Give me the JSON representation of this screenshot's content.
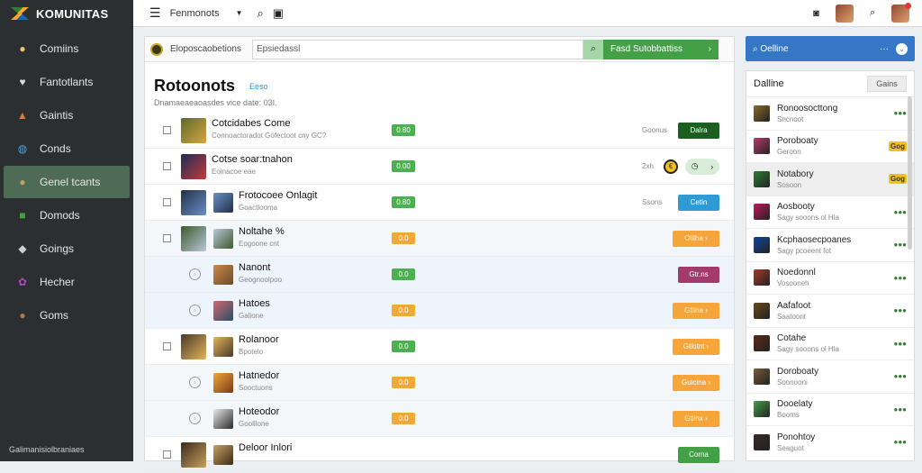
{
  "brand": {
    "name": "KOMUNITAS"
  },
  "sidebar": {
    "items": [
      {
        "label": "Comiins",
        "icon": "person-icon",
        "color": "#f0c070"
      },
      {
        "label": "Fantotlants",
        "icon": "heart-icon",
        "color": "#d8d8d8"
      },
      {
        "label": "Gaintis",
        "icon": "fox-icon",
        "color": "#e07b39"
      },
      {
        "label": "Conds",
        "icon": "globe-icon",
        "color": "#4aa3df"
      },
      {
        "label": "Genel tcants",
        "icon": "person-icon",
        "color": "#c69b6d",
        "active": true
      },
      {
        "label": "Domods",
        "icon": "box-icon",
        "color": "#43a047"
      },
      {
        "label": "Goings",
        "icon": "gamepad-icon",
        "color": "#d0d0d0"
      },
      {
        "label": "Hecher",
        "icon": "palette-icon",
        "color": "#ab47bc"
      },
      {
        "label": "Goms",
        "icon": "person-icon",
        "color": "#b07a50"
      }
    ],
    "footer": "Galimanisiolbraniaes"
  },
  "topbar": {
    "breadcrumb": "Fenmonots",
    "menu_icon": "☰",
    "chevron": "▼",
    "search_icon": "⌕",
    "camera_icon": "▣",
    "bell_icon": "◙",
    "search_icon_right": "⌕"
  },
  "filterbar": {
    "label": "Eloposcaobetions",
    "search_value": "Epsiedassl",
    "search_icon": "⌕",
    "cta_label": "Fasd Sutobbattiss",
    "cta_chevron": "›"
  },
  "page": {
    "title": "Rotoonots",
    "tag": "Eeso",
    "subtitle": "Dnamaeaeaoasdes vice date: 03I."
  },
  "rows": [
    {
      "title": "Cotcidabes Come",
      "subtitle": "Connoactoradot Gofectoot cny GC?",
      "score": "0.80",
      "score_type": "g",
      "meta": "Goonus",
      "action": "Dalra",
      "action_type": "dark",
      "checkbox": true,
      "style": ""
    },
    {
      "title": "Cotse soar:tnahon",
      "subtitle": "Eoinacoe eae",
      "score": "0.00",
      "score_type": "g",
      "meta": "2xh",
      "action": "",
      "action_type": "pill",
      "checkbox": true,
      "style": ""
    },
    {
      "title": "Frotocoee Onlagit",
      "subtitle": "Goactlooma",
      "score": "0.80",
      "score_type": "g",
      "meta": "Ssons",
      "action": "Cetin",
      "action_type": "blue",
      "checkbox": true,
      "style": ""
    },
    {
      "title": "Noltahe %",
      "subtitle": "Eogoone cnt",
      "score": "0.0",
      "score_type": "o",
      "meta": "",
      "action": "Oiliha ›",
      "action_type": "orange",
      "checkbox": true,
      "style": "alt"
    },
    {
      "title": "Nanont",
      "subtitle": "Geognoolpoo",
      "score": "0.0",
      "score_type": "g",
      "meta": "",
      "action": "Gtr.ns",
      "action_type": "plum",
      "checkbox": false,
      "style": "hi"
    },
    {
      "title": "Hatoes",
      "subtitle": "Galione",
      "score": "0.0",
      "score_type": "o",
      "meta": "",
      "action": "Gtlina ›",
      "action_type": "orange",
      "checkbox": false,
      "style": "hi"
    },
    {
      "title": "Rolanoor",
      "subtitle": "Bpotelo",
      "score": "0.0",
      "score_type": "g",
      "meta": "",
      "action": "Gtlotnt ›",
      "action_type": "orange",
      "checkbox": true,
      "style": ""
    },
    {
      "title": "Hatnedor",
      "subtitle": "Sooctuons",
      "score": "0.0",
      "score_type": "o",
      "meta": "",
      "action": "Guicina ›",
      "action_type": "orange",
      "checkbox": false,
      "style": "alt"
    },
    {
      "title": "Hoteodor",
      "subtitle": "Goolllone",
      "score": "0.0",
      "score_type": "o",
      "meta": "",
      "action": "Gtlinx ›",
      "action_type": "orange",
      "checkbox": false,
      "style": "alt"
    },
    {
      "title": "Deloor Inlori",
      "subtitle": "",
      "score": "",
      "score_type": "g",
      "meta": "",
      "action": "Corna",
      "action_type": "green",
      "checkbox": true,
      "style": ""
    }
  ],
  "right_panel": {
    "header": "Oelline",
    "header_menu": "···",
    "header_chevron": "⌄",
    "title": "Dalline",
    "button": "Gains",
    "items": [
      {
        "a": "Ronoosocttong",
        "b": "Sncnoot",
        "score": "●●●",
        "type": "g"
      },
      {
        "a": "Poroboaty",
        "b": "Geroon",
        "score": "Gog",
        "type": "y"
      },
      {
        "a": "Notabory",
        "b": "Sosoon",
        "score": "Gog",
        "type": "y",
        "selected": true
      },
      {
        "a": "Aosbooty",
        "b": "Sagy sooons ol Hla",
        "score": "●●●",
        "type": "g"
      },
      {
        "a": "Kcphaosecpoanes",
        "b": "Sagy pcoeent fot",
        "score": "●●●",
        "type": "g"
      },
      {
        "a": "Noedonnl",
        "b": "Vosooneh",
        "score": "●●●",
        "type": "g"
      },
      {
        "a": "Aafafoot",
        "b": "Saatoont",
        "score": "●●●",
        "type": "g"
      },
      {
        "a": "Cotahe",
        "b": "Sagy sooons ol Hla",
        "score": "●●●",
        "type": "g"
      },
      {
        "a": "Doroboaty",
        "b": "Soonooni",
        "score": "●●●",
        "type": "g"
      },
      {
        "a": "Dooelaty",
        "b": "Booms",
        "score": "●●●",
        "type": "g"
      },
      {
        "a": "Ponohtoy",
        "b": "Seaguot",
        "score": "●●●",
        "type": "g"
      }
    ]
  }
}
